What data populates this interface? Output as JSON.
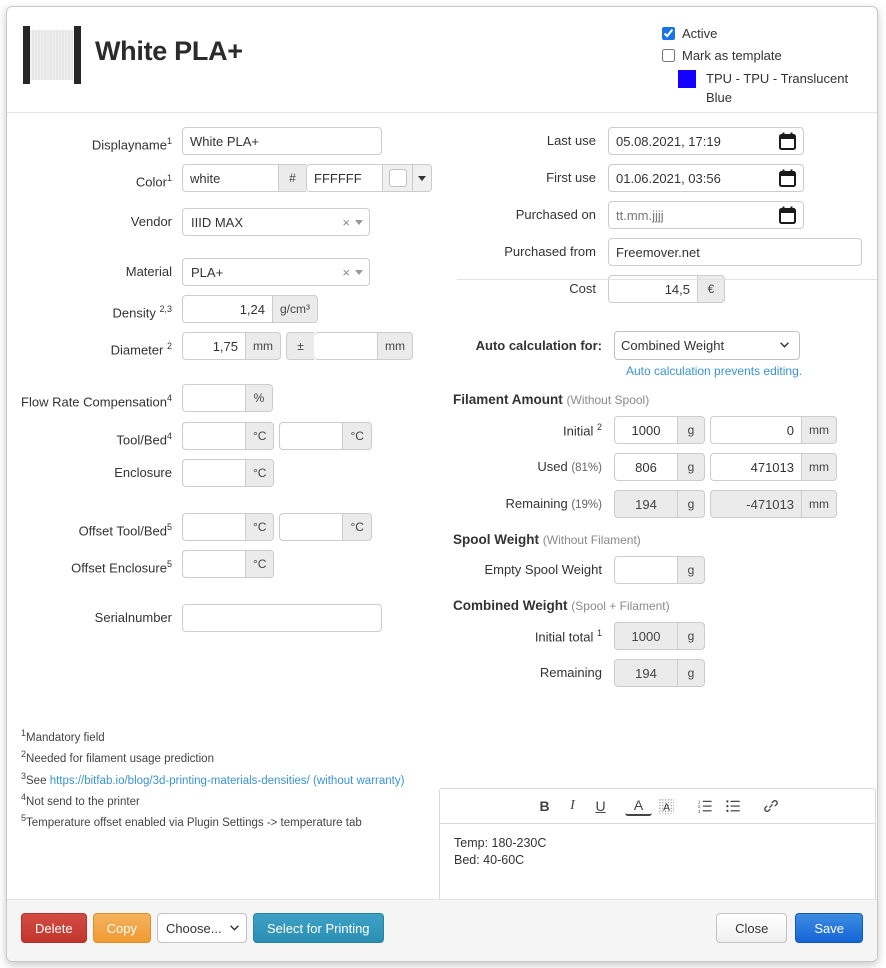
{
  "header": {
    "title": "White PLA+",
    "spool_icon": "filament-spool-icon",
    "active_label": "Active",
    "active_checked": true,
    "template_label": "Mark as template",
    "template_checked": false,
    "template_color": "#1500ff",
    "template_value": "TPU - TPU - Translucent Blue"
  },
  "left": {
    "displayname": {
      "label": "Displayname",
      "sup": "1",
      "value": "White PLA+"
    },
    "color": {
      "label": "Color",
      "sup": "1",
      "name_value": "white",
      "hash": "#",
      "hex_value": "FFFFFF",
      "swatch": "#FFFFFF"
    },
    "vendor": {
      "label": "Vendor",
      "value": "IIID MAX",
      "clear": "×"
    },
    "material": {
      "label": "Material",
      "value": "PLA+",
      "clear": "×"
    },
    "density": {
      "label": "Density",
      "sup": "2,3",
      "value": "1,24",
      "unit": "g/cm³"
    },
    "diameter": {
      "label": "Diameter",
      "sup": "2",
      "value": "1,75",
      "unit": "mm",
      "pm": "±",
      "tol_value": "",
      "tol_unit": "mm"
    },
    "flow_rate": {
      "label": "Flow Rate Compensation",
      "sup": "4",
      "value": "",
      "unit": "%"
    },
    "tool_bed": {
      "label": "Tool/Bed",
      "sup": "4",
      "tool_value": "",
      "tool_unit": "°C",
      "bed_value": "",
      "bed_unit": "°C"
    },
    "enclosure": {
      "label": "Enclosure",
      "value": "",
      "unit": "°C"
    },
    "offset_tool_bed": {
      "label": "Offset Tool/Bed",
      "sup": "5",
      "tool_value": "",
      "tool_unit": "°C",
      "bed_value": "",
      "bed_unit": "°C"
    },
    "offset_enclosure": {
      "label": "Offset Enclosure",
      "sup": "5",
      "value": "",
      "unit": "°C"
    },
    "serialnumber": {
      "label": "Serialnumber",
      "value": ""
    },
    "notes": [
      {
        "sup": "1",
        "text": "Mandatory field"
      },
      {
        "sup": "2",
        "text": "Needed for filament usage prediction"
      },
      {
        "sup": "3",
        "pre": "See ",
        "link": "https://bitfab.io/blog/3d-printing-materials-densities/ (without warranty)"
      },
      {
        "sup": "4",
        "text": "Not send to the printer"
      },
      {
        "sup": "5",
        "text": "Temperature offset enabled via Plugin Settings -> temperature tab"
      }
    ]
  },
  "right": {
    "last_use": {
      "label": "Last use",
      "value": "05.08.2021, 17:19"
    },
    "first_use": {
      "label": "First use",
      "value": "01.06.2021, 03:56"
    },
    "purchased_on": {
      "label": "Purchased on",
      "value": "",
      "placeholder": "tt.mm.jjjj"
    },
    "purchased_from": {
      "label": "Purchased from",
      "value": "Freemover.net"
    },
    "cost": {
      "label": "Cost",
      "value": "14,5",
      "unit": "€"
    },
    "auto_calc": {
      "label": "Auto calculation for:",
      "selected": "Combined Weight",
      "options": [
        "Combined Weight"
      ],
      "hint": "Auto calculation prevents editing."
    },
    "filament_amount": {
      "heading": "Filament Amount",
      "sub": "(Without Spool)",
      "rows": [
        {
          "label": "Initial",
          "sup": "2",
          "pct": "",
          "grams": "1000",
          "g_unit": "g",
          "length": "0",
          "l_unit": "mm",
          "readonly": false
        },
        {
          "label": "Used",
          "sup": "",
          "pct": "(81%)",
          "grams": "806",
          "g_unit": "g",
          "length": "471013",
          "l_unit": "mm",
          "readonly": false
        },
        {
          "label": "Remaining",
          "sup": "",
          "pct": "(19%)",
          "grams": "194",
          "g_unit": "g",
          "length": "-471013",
          "l_unit": "mm",
          "readonly": true
        }
      ]
    },
    "spool_weight": {
      "heading": "Spool Weight",
      "sub": "(Without Filament)",
      "row": {
        "label": "Empty Spool Weight",
        "value": "",
        "unit": "g"
      }
    },
    "combined_weight": {
      "heading": "Combined Weight",
      "sub": "(Spool + Filament)",
      "rows": [
        {
          "label": "Initial total",
          "sup": "1",
          "value": "1000",
          "unit": "g",
          "readonly": true
        },
        {
          "label": "Remaining",
          "sup": "",
          "value": "194",
          "unit": "g",
          "readonly": true
        }
      ]
    },
    "editor": {
      "tools": [
        {
          "name": "bold-icon",
          "glyph": "B"
        },
        {
          "name": "italic-icon",
          "glyph": "I"
        },
        {
          "name": "underline-icon",
          "glyph": "U"
        },
        {
          "name": "text-color-icon",
          "glyph": "A"
        },
        {
          "name": "highlight-color-icon",
          "glyph": "A"
        },
        {
          "name": "ordered-list-icon",
          "glyph": ""
        },
        {
          "name": "unordered-list-icon",
          "glyph": ""
        },
        {
          "name": "link-icon",
          "glyph": ""
        }
      ],
      "line1": "Temp:  180-230C",
      "line2": "Bed: 40-60C"
    }
  },
  "footer": {
    "delete": "Delete",
    "copy": "Copy",
    "choose_selected": "Choose...",
    "choose_options": [
      "Choose..."
    ],
    "select_for_printing": "Select for Printing",
    "close": "Close",
    "save": "Save"
  },
  "colors": {
    "link": "#3a93d4",
    "save": "#1565d8",
    "delete": "#c2352c",
    "copy": "#ef9b31",
    "print": "#2b8fb5",
    "template_chip": "#1500ff"
  }
}
